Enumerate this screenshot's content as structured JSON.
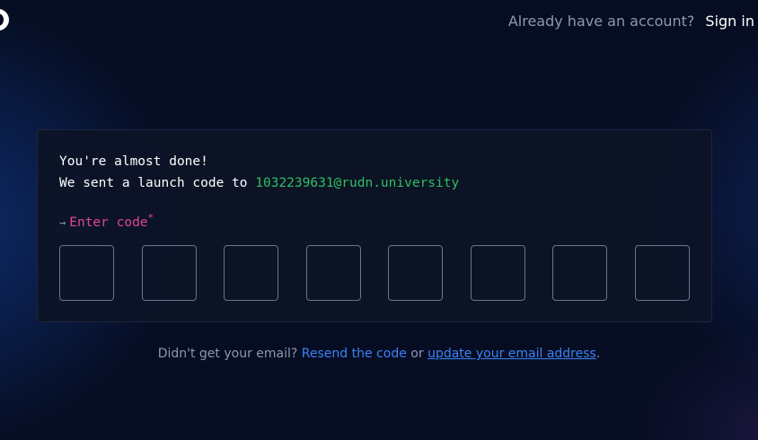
{
  "header": {
    "logo_icon": "brand-logo-icon",
    "already_text": "Already have an account?",
    "signin_label": "Sign in"
  },
  "card": {
    "heading": "You're almost done!",
    "sent_prefix": "We sent a launch code to",
    "email": "1032239631@rudn.university",
    "arrow": "→",
    "code_label": "Enter code",
    "required_mark": "*",
    "code_boxes": [
      "",
      "",
      "",
      "",
      "",
      "",
      "",
      ""
    ]
  },
  "footer": {
    "prefix": "Didn't get your email?",
    "resend_label": "Resend the code",
    "or_text": "or",
    "update_label": "update your email address",
    "suffix": "."
  },
  "colors": {
    "background": "#060d22",
    "card": "#0d1426",
    "email_green": "#2fbf63",
    "label_pink": "#e0459a",
    "link_blue": "#3b82f6"
  }
}
